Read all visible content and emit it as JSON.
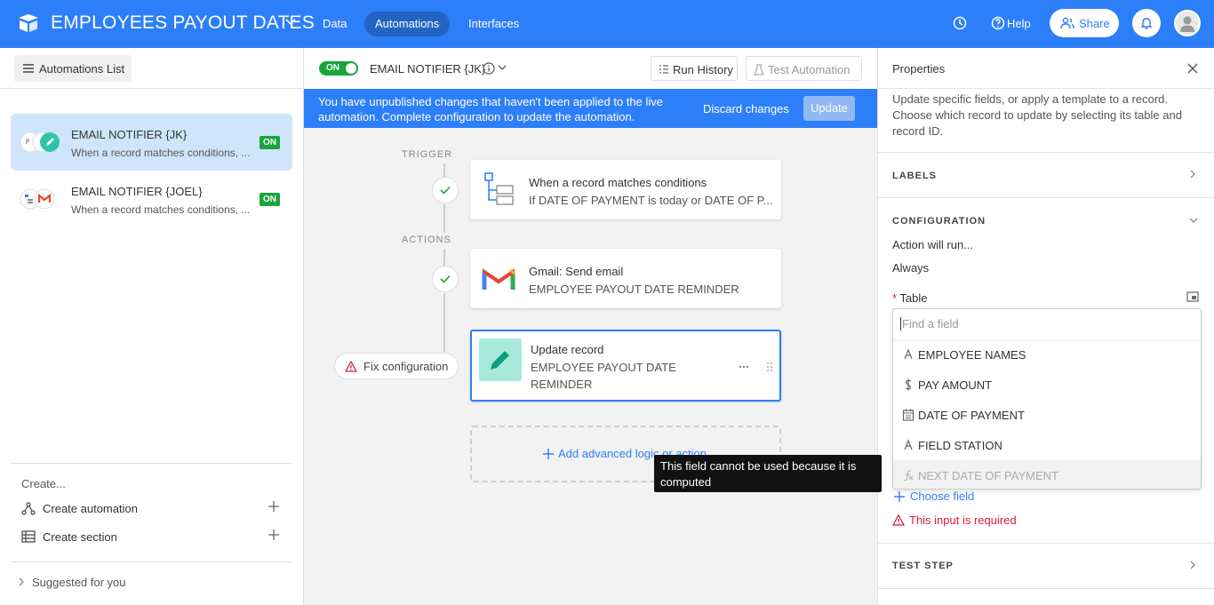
{
  "app": {
    "title": "EMPLOYEES PAYOUT DATES",
    "nav": [
      "Data",
      "Automations",
      "Interfaces"
    ],
    "help_label": "Help",
    "share_label": "Share",
    "brand_color": "#2d7ff9"
  },
  "sidebar": {
    "list_button": "Automations List",
    "automations": [
      {
        "name": "EMAIL NOTIFIER {JK}",
        "desc": "When a record matches conditions, ...",
        "status": "ON"
      },
      {
        "name": "EMAIL NOTIFIER {JOEL}",
        "desc": "When a record matches conditions, ...",
        "status": "ON"
      }
    ],
    "create_label": "Create...",
    "create_automation": "Create automation",
    "create_section": "Create section",
    "suggested": "Suggested for you"
  },
  "editor": {
    "toggle_label": "ON",
    "automation_name": "EMAIL NOTIFIER {JK}",
    "run_history": "Run History",
    "test_automation": "Test Automation",
    "banner_message": "You have unpublished changes that haven't been applied to the live automation. Complete configuration to update the automation.",
    "discard": "Discard changes",
    "update": "Update",
    "trigger_label": "TRIGGER",
    "actions_label": "ACTIONS",
    "trigger": {
      "title": "When a record matches conditions",
      "sub": "If DATE OF PAYMENT is today or DATE OF P..."
    },
    "action1": {
      "title": "Gmail: Send email",
      "sub": "EMPLOYEE PAYOUT DATE REMINDER"
    },
    "action2": {
      "title": "Update record",
      "sub_line1": "EMPLOYEE PAYOUT DATE",
      "sub_line2": "REMINDER"
    },
    "fix_config": "Fix configuration",
    "add_logic": "Add advanced logic or action",
    "tooltip": "This field cannot be used because it is computed"
  },
  "properties": {
    "title": "Properties",
    "description": "Update specific fields, or apply a template to a record. Choose which record to update by selecting its table and record ID.",
    "labels_section": "LABELS",
    "configuration_section": "CONFIGURATION",
    "action_will_run": "Action will run...",
    "always": "Always",
    "table_label": "Table",
    "search_placeholder": "Find a field",
    "fields": [
      {
        "name": "EMPLOYEE NAMES",
        "icon": "text-field-icon"
      },
      {
        "name": "PAY AMOUNT",
        "icon": "currency-field-icon"
      },
      {
        "name": "DATE OF PAYMENT",
        "icon": "date-field-icon"
      },
      {
        "name": "FIELD STATION",
        "icon": "text-field-icon"
      },
      {
        "name": "NEXT DATE OF PAYMENT",
        "icon": "formula-field-icon",
        "disabled": true
      }
    ],
    "choose_field": "Choose field",
    "required_msg": "This input is required",
    "test_step": "TEST STEP"
  }
}
